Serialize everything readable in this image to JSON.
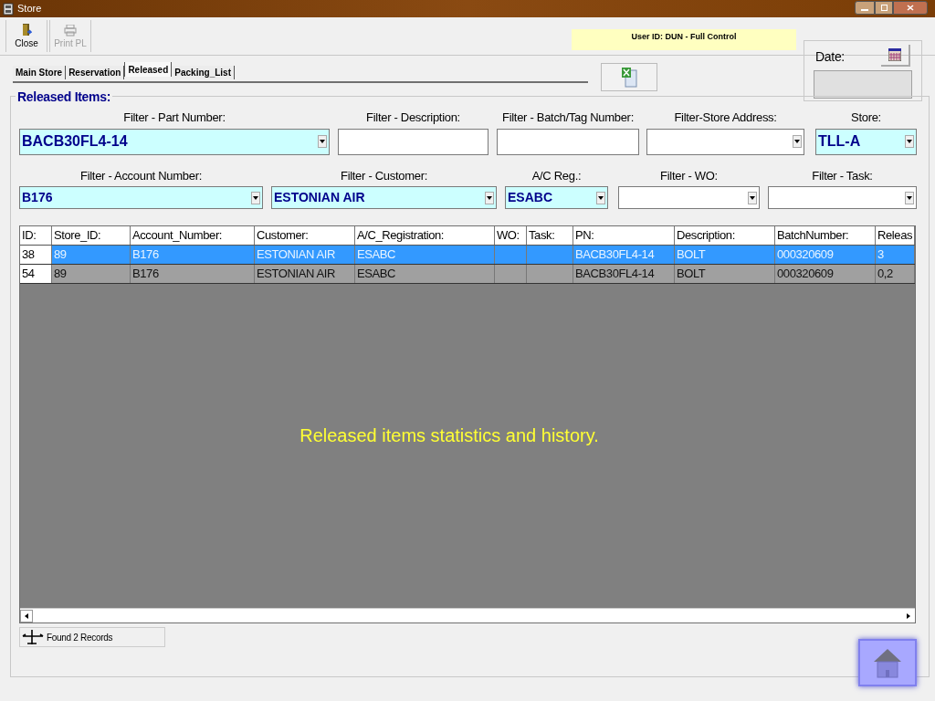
{
  "window": {
    "title": "Store"
  },
  "toolbar": [
    {
      "label": "Close",
      "disabled": false
    },
    {
      "label": "Print PL",
      "disabled": true
    }
  ],
  "user_info": "User ID: DUN - Full Control",
  "tabs": [
    {
      "label": "Main Store",
      "selected": false
    },
    {
      "label": "Reservation",
      "selected": false
    },
    {
      "label": "Released",
      "selected": true
    },
    {
      "label": "Packing_List",
      "selected": false
    }
  ],
  "date": {
    "label": "Date:"
  },
  "group_title": "Released Items:",
  "filter_rows": [
    [
      {
        "label": "Filter - Part Number:",
        "kind": "combo",
        "value": "BACB30FL4-14"
      },
      {
        "label": "Filter - Description:",
        "kind": "text"
      },
      {
        "label": "Filter - Batch/Tag Number:",
        "kind": "text"
      },
      {
        "label": "Filter-Store Address:",
        "kind": "combo"
      },
      {
        "label": "Store:",
        "kind": "combo",
        "value": "TLL-A"
      }
    ],
    [
      {
        "label": "Filter - Account Number:",
        "kind": "combo",
        "value": "B176"
      },
      {
        "label": "Filter - Customer:",
        "kind": "combo",
        "value": "ESTONIAN AIR"
      },
      {
        "label": "A/C Reg.:",
        "kind": "combo",
        "value": "ESABC"
      },
      {
        "label": "Filter - WO:",
        "kind": "combo"
      },
      {
        "label": "Filter - Task:",
        "kind": "combo"
      }
    ]
  ],
  "table": {
    "columns": [
      "ID:",
      "Store_ID:",
      "Account_Number:",
      "Customer:",
      "A/C_Registration:",
      "WO:",
      "Task:",
      "PN:",
      "Description:",
      "BatchNumber:",
      "Releas"
    ],
    "rows": [
      {
        "cells": [
          "38",
          "89",
          "B176",
          "ESTONIAN AIR",
          "ESABC",
          "",
          "",
          "BACB30FL4-14",
          "BOLT",
          "000320609",
          "3"
        ],
        "selected": true
      },
      {
        "cells": [
          "54",
          "89",
          "B176",
          "ESTONIAN AIR",
          "ESABC",
          "",
          "",
          "BACB30FL4-14",
          "BOLT",
          "000320609",
          "0,2"
        ],
        "selected": false
      }
    ],
    "overlay_text": "Released items statistics and history."
  },
  "status_bar": "Found 2 Records"
}
